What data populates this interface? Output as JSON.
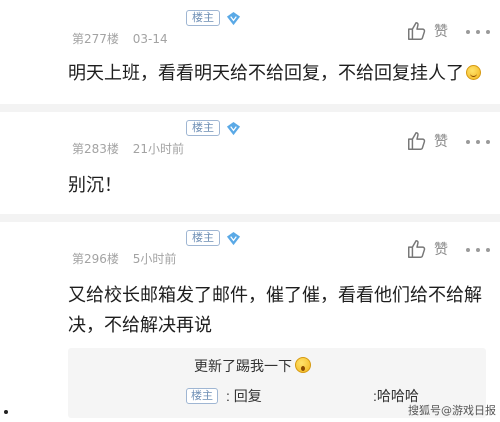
{
  "posts": [
    {
      "owner_tag": "楼主",
      "level_icon": "diamond-icon",
      "floor": "第277楼",
      "time": "03-14",
      "like_label": "赞",
      "content": "明天上班，看看明天给不给回复，不给回复挂人了"
    },
    {
      "owner_tag": "楼主",
      "level_icon": "diamond-icon",
      "floor": "第283楼",
      "time": "21小时前",
      "like_label": "赞",
      "content": "别沉！"
    },
    {
      "owner_tag": "楼主",
      "level_icon": "diamond-icon",
      "floor": "第296楼",
      "time": "5小时前",
      "like_label": "赞",
      "content": "又给校长邮箱发了邮件，催了催，看看他们给不给解决，不给解决再说"
    }
  ],
  "reply_box": {
    "line1": "更新了踢我一下",
    "owner_tag": "楼主",
    "reply_label": ": 回复",
    "reply_text": ":哈哈哈"
  },
  "watermark": "搜狐号@游戏日报",
  "colors": {
    "owner_tag": "#6f8fb5",
    "meta": "#a3a3a3",
    "reply_bg": "#f5f5f5",
    "level_icon": "#5aa9e6"
  }
}
